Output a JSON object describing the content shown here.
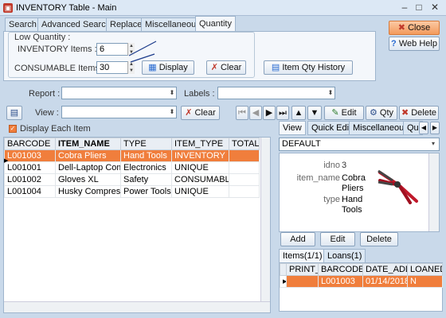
{
  "window": {
    "title": "INVENTORY Table - Main",
    "icon": "inventory-app-icon"
  },
  "tabs": [
    "Search",
    "Advanced Search",
    "Replace",
    "Miscellaneous",
    "Quantity"
  ],
  "active_tab": "Quantity",
  "side_buttons": {
    "close": "Close",
    "web_help": "Web Help"
  },
  "low_quantity": {
    "group_label": "Low Quantity :",
    "inventory_label": "INVENTORY Items :",
    "inventory_value": "6",
    "consumable_label": "CONSUMABLE Items :",
    "consumable_value": "30",
    "display": "Display",
    "clear": "Clear",
    "history": "Item Qty History"
  },
  "report_row": {
    "report_label": "Report :",
    "labels_label": "Labels :"
  },
  "view_row": {
    "view_label": "View :",
    "clear": "Clear",
    "edit": "Edit",
    "qty": "Qty",
    "delete": "Delete"
  },
  "display_each_item": "Display Each Item",
  "grid": {
    "columns": [
      "BARCODE",
      "ITEM_NAME",
      "TYPE",
      "ITEM_TYPE",
      "TOTAL_"
    ],
    "rows": [
      [
        "L001003",
        "Cobra Pliers",
        "Hand Tools",
        "INVENTORY",
        ""
      ],
      [
        "L001001",
        "Dell-Laptop Comp",
        "Electronics",
        "UNIQUE",
        ""
      ],
      [
        "L001002",
        "Gloves XL",
        "Safety",
        "CONSUMABLE",
        ""
      ],
      [
        "L001004",
        "Husky Compresso",
        "Power Tools",
        "UNIQUE",
        ""
      ]
    ],
    "selected_index": 0
  },
  "detail": {
    "tabs": [
      "View",
      "Quick Edit",
      "Miscellaneous",
      "Qu"
    ],
    "view_name": "DEFAULT",
    "fields": [
      {
        "label": "idno",
        "value": "3"
      },
      {
        "label": "item_name",
        "value": "Cobra Pliers"
      },
      {
        "label": "type",
        "value": "Hand Tools"
      }
    ],
    "buttons": {
      "add": "Add",
      "edit": "Edit",
      "delete": "Delete"
    },
    "sub_tabs": [
      "Items(1/1)",
      "Loans(1)"
    ],
    "sub_columns": [
      "PRINT_I",
      "BARCODE",
      "DATE_ADDI",
      "LOANED"
    ],
    "sub_row": [
      "",
      "L001003",
      "01/14/2018",
      "N"
    ]
  },
  "colors": {
    "selection": "#f07e3c",
    "close_button": "#f6a56b",
    "background": "#c9d9ea"
  }
}
